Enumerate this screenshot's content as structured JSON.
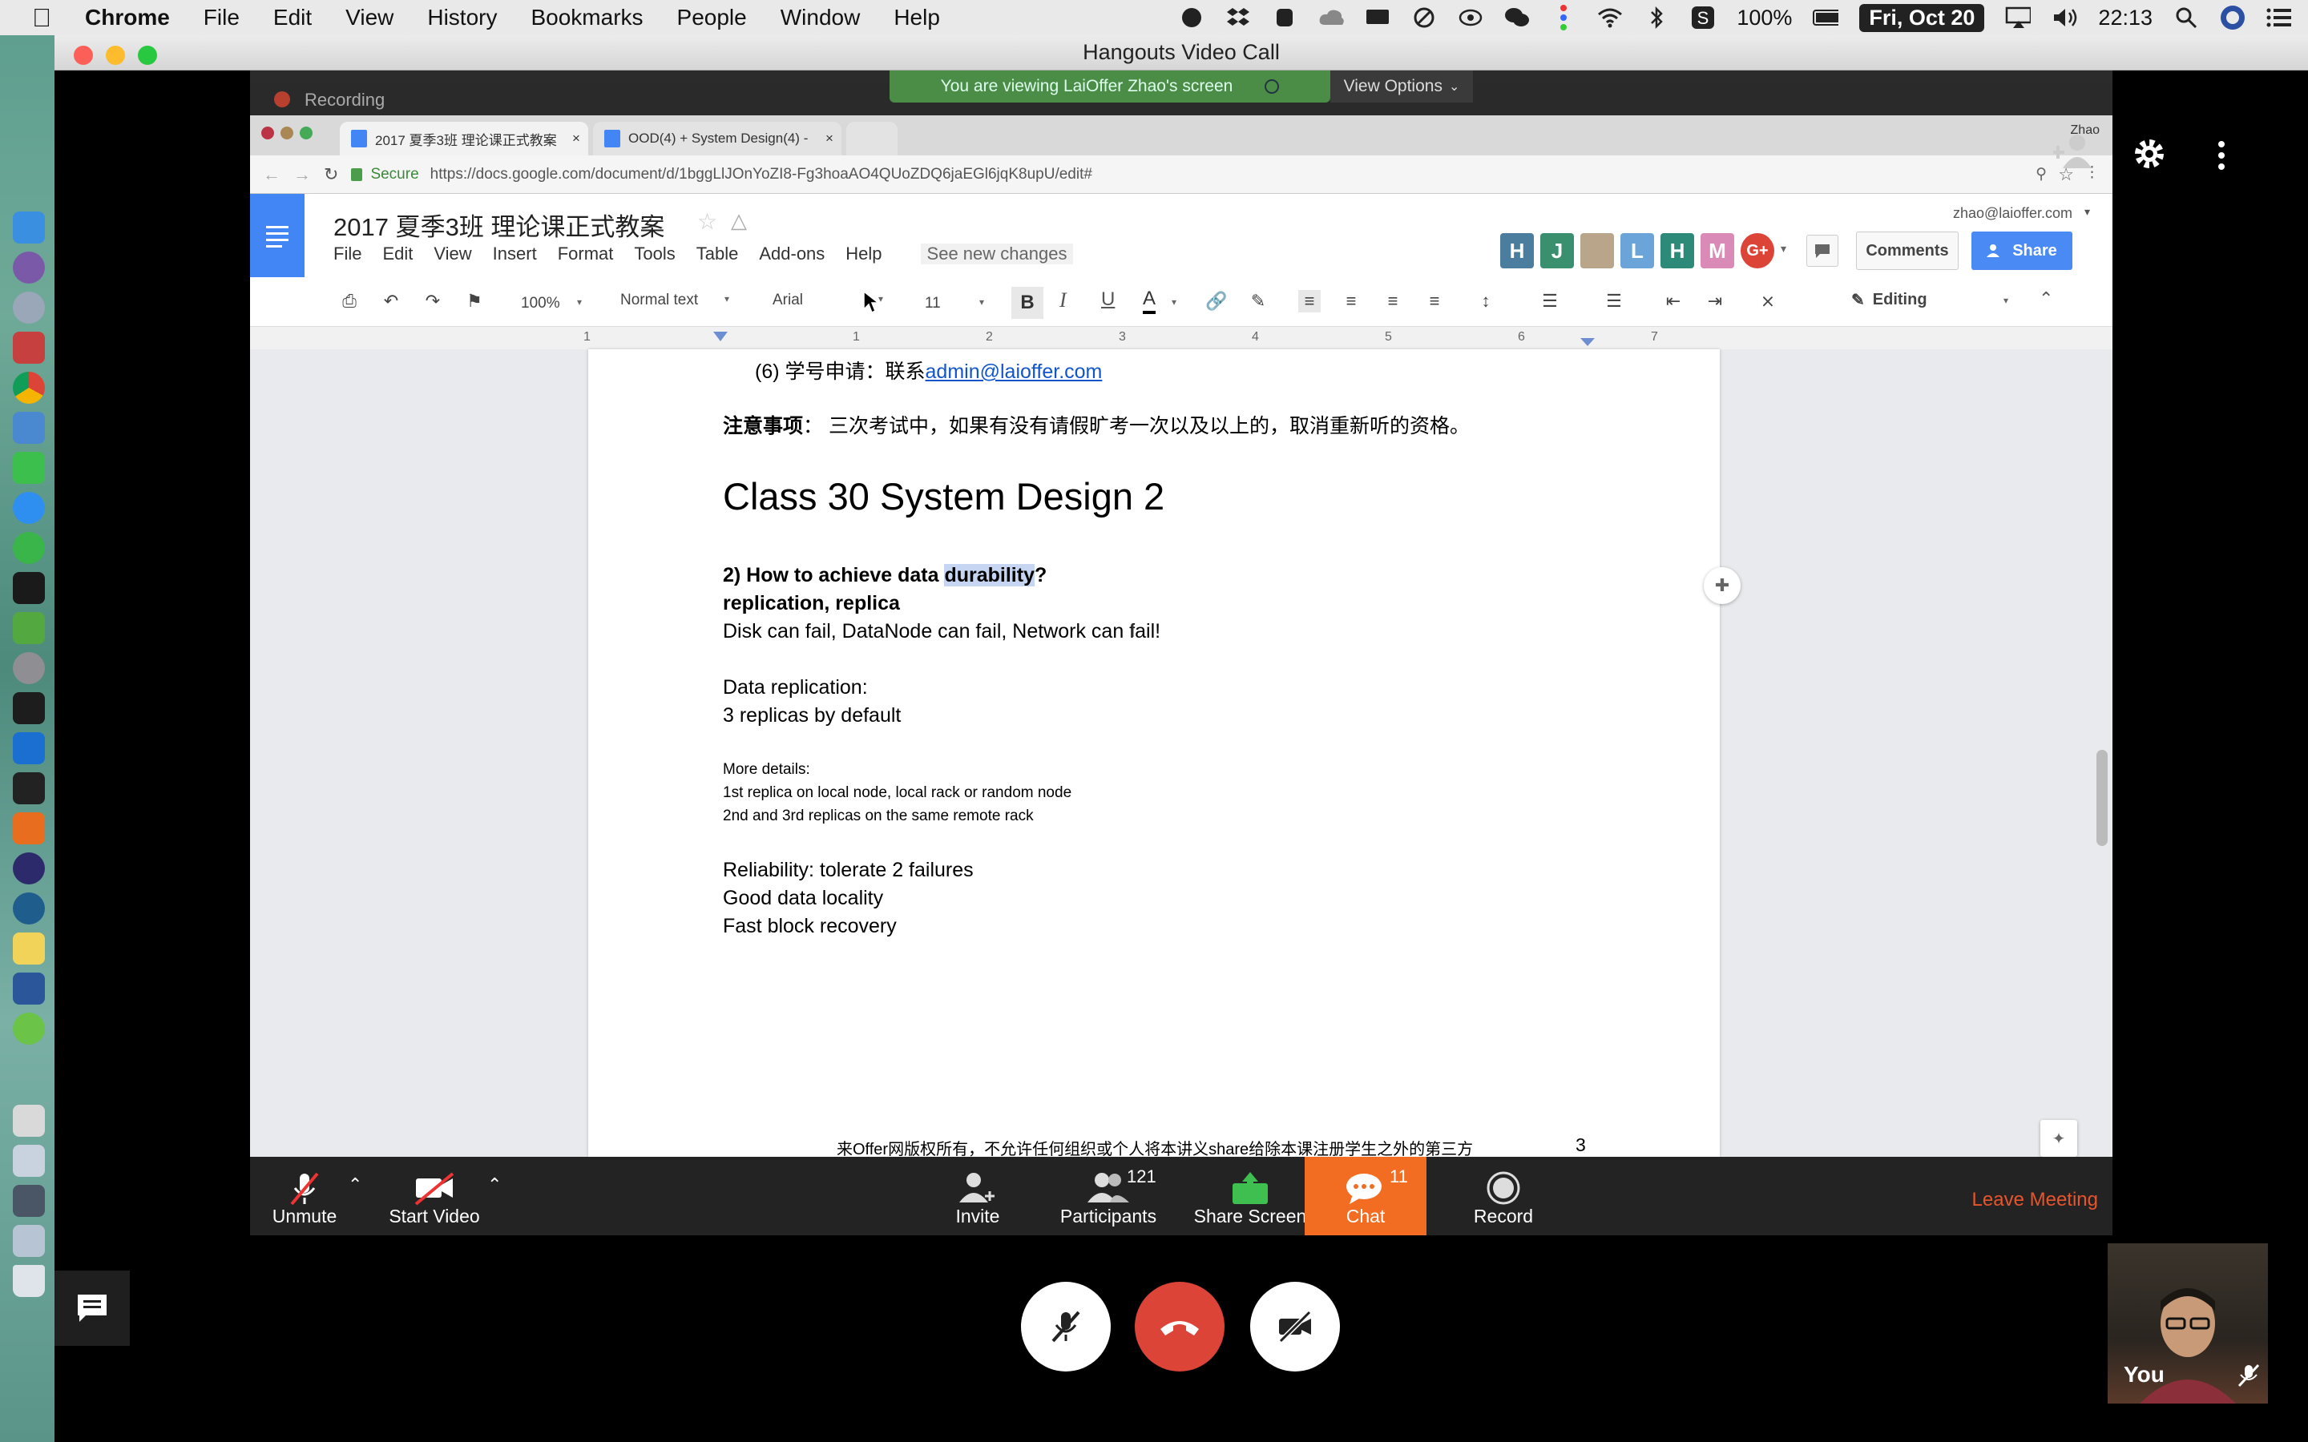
{
  "menubar": {
    "app": "Chrome",
    "items": [
      "File",
      "Edit",
      "View",
      "History",
      "Bookmarks",
      "People",
      "Window",
      "Help"
    ],
    "battery": "100%",
    "date": "Fri, Oct 20",
    "time": "22:13"
  },
  "window": {
    "title": "Hangouts Video Call"
  },
  "share": {
    "recording": "Recording",
    "viewing": "You are viewing LaiOffer Zhao's screen",
    "view_options": "View Options"
  },
  "browser": {
    "tabs": [
      "2017 夏季3班 理论课正式教案",
      "OOD(4) + System Design(4) -"
    ],
    "secure": "Secure",
    "url": "https://docs.google.com/document/d/1bggLlJOnYoZI8-Fg3hoaAO4QUoZDQ6jaEGl6jqK8upU/edit#",
    "profile": "Zhao"
  },
  "docs": {
    "title": "2017 夏季3班 理论课正式教案",
    "menu": [
      "File",
      "Edit",
      "View",
      "Insert",
      "Format",
      "Tools",
      "Table",
      "Add-ons",
      "Help"
    ],
    "see_changes": "See new changes",
    "account": "zhao@laioffer.com",
    "avatars": [
      {
        "letter": "H",
        "color": "#4a7d9e"
      },
      {
        "letter": "J",
        "color": "#3a8f6e"
      },
      {
        "letter": "",
        "color": "#b9a58a"
      },
      {
        "letter": "L",
        "color": "#6aa4d9"
      },
      {
        "letter": "H",
        "color": "#2e8a78"
      },
      {
        "letter": "M",
        "color": "#d98ab6"
      },
      {
        "letter": "G+",
        "color": "#db4437"
      }
    ],
    "comments": "Comments",
    "share": "Share",
    "zoom": "100%",
    "style": "Normal text",
    "font": "Arial",
    "size": "11",
    "mode": "Editing",
    "ruler": [
      "1",
      "1",
      "2",
      "3",
      "4",
      "5",
      "6",
      "7"
    ]
  },
  "doc": {
    "line_apply": "(6) 学号申请：联系",
    "email": "admin@laioffer.com",
    "note_label": "注意事项",
    "note_text": "：  三次考试中，如果有没有请假旷考一次以及以上的，取消重新听的资格。",
    "heading": "Class 30 System Design 2",
    "q_prefix": "2) How to achieve data ",
    "q_highlight": "durability",
    "q_suffix": "?",
    "replication": "replication, replica",
    "failures": "Disk can fail, DataNode can fail, Network can fail!",
    "data_rep": "Data replication:",
    "three_rep": "3 replicas by default",
    "more": "More details:",
    "detail1": "1st replica on local node, local rack or random node",
    "detail2": "2nd and 3rd replicas on the same remote rack",
    "reliability": "Reliability: tolerate 2 failures",
    "locality": "Good data locality",
    "recovery": "Fast block recovery",
    "footer": "来Offer网版权所有，不允许任何组织或个人将本讲义share给除本课注册学生之外的第三方",
    "page_number": "3"
  },
  "zoom": {
    "unmute": "Unmute",
    "start_video": "Start Video",
    "invite": "Invite",
    "participants": "Participants",
    "participants_count": "121",
    "share_screen": "Share Screen",
    "chat": "Chat",
    "chat_count": "11",
    "record": "Record",
    "leave": "Leave Meeting"
  },
  "self_view": {
    "label": "You"
  },
  "colors": {
    "zoom_chat": "#f26d21",
    "leave": "#e8542b",
    "hangup": "#db4437",
    "share_btn": "#4a8af4"
  }
}
